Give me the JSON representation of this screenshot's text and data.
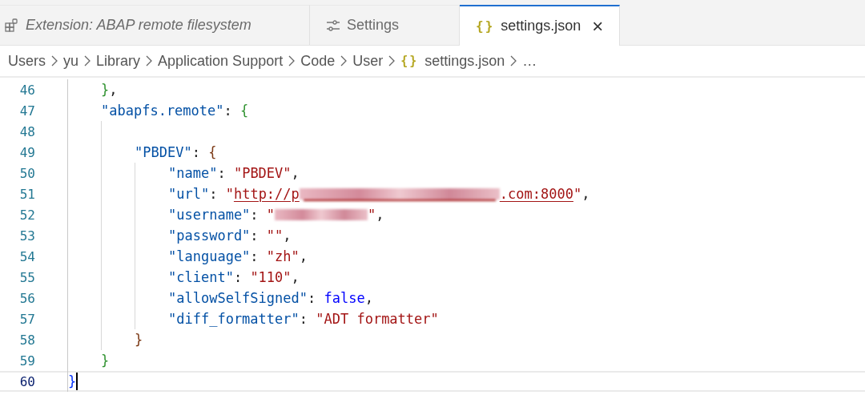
{
  "tabs": [
    {
      "kind": "extension",
      "label": "Extension: ABAP remote filesystem",
      "selected": false
    },
    {
      "kind": "settings",
      "label": "Settings",
      "selected": false
    },
    {
      "kind": "file",
      "glyph": "{}",
      "label": "settings.json",
      "selected": true
    }
  ],
  "close_glyph": "×",
  "breadcrumbs": [
    {
      "label": "Users"
    },
    {
      "label": "yu"
    },
    {
      "label": "Library"
    },
    {
      "label": "Application Support"
    },
    {
      "label": "Code"
    },
    {
      "label": "User"
    },
    {
      "glyph": "{}",
      "label": "settings.json"
    },
    {
      "label": "…"
    }
  ],
  "editor": {
    "lines": [
      {
        "number": "46",
        "current": false,
        "tokens": [
          {
            "kind": "brace1",
            "t": "}"
          },
          {
            "kind": "punct",
            "t": ","
          }
        ]
      },
      {
        "number": "47",
        "current": false,
        "tokens": [
          {
            "kind": "key",
            "t": "\"abapfs.remote\""
          },
          {
            "kind": "punct",
            "t": ": "
          },
          {
            "kind": "brace1",
            "t": "{"
          }
        ],
        "children": [
          {
            "number": "48",
            "current": false
          },
          {
            "number": "49",
            "current": false,
            "tokens": [
              {
                "kind": "key",
                "t": "\"PBDEV\""
              },
              {
                "kind": "punct",
                "t": ": "
              },
              {
                "kind": "brace2",
                "t": "{"
              }
            ],
            "children": [
              {
                "number": "50",
                "current": false,
                "tokens": [
                  {
                    "kind": "key",
                    "t": "\"name\""
                  },
                  {
                    "kind": "punct",
                    "t": ": "
                  },
                  {
                    "kind": "string",
                    "t": "\"PBDEV\""
                  },
                  {
                    "kind": "punct",
                    "t": ","
                  }
                ]
              },
              {
                "number": "51",
                "current": false,
                "tokens": [
                  {
                    "kind": "key",
                    "t": "\"url\""
                  },
                  {
                    "kind": "punct",
                    "t": ": "
                  },
                  {
                    "kind": "string",
                    "t": "\""
                  },
                  {
                    "kind": "link",
                    "t": "http://p"
                  },
                  {
                    "kind": "redacted_link"
                  },
                  {
                    "kind": "link",
                    "t": ".com:8000"
                  },
                  {
                    "kind": "string",
                    "t": "\""
                  },
                  {
                    "kind": "punct",
                    "t": ","
                  }
                ]
              },
              {
                "number": "52",
                "current": false,
                "tokens": [
                  {
                    "kind": "key",
                    "t": "\"username\""
                  },
                  {
                    "kind": "punct",
                    "t": ": "
                  },
                  {
                    "kind": "string",
                    "t": "\""
                  },
                  {
                    "kind": "redacted_string"
                  },
                  {
                    "kind": "string",
                    "t": "\""
                  },
                  {
                    "kind": "punct",
                    "t": ","
                  }
                ]
              },
              {
                "number": "53",
                "current": false,
                "tokens": [
                  {
                    "kind": "key",
                    "t": "\"password\""
                  },
                  {
                    "kind": "punct",
                    "t": ": "
                  },
                  {
                    "kind": "string",
                    "t": "\"\""
                  },
                  {
                    "kind": "punct",
                    "t": ","
                  }
                ]
              },
              {
                "number": "54",
                "current": false,
                "tokens": [
                  {
                    "kind": "key",
                    "t": "\"language\""
                  },
                  {
                    "kind": "punct",
                    "t": ": "
                  },
                  {
                    "kind": "string",
                    "t": "\"zh\""
                  },
                  {
                    "kind": "punct",
                    "t": ","
                  }
                ]
              },
              {
                "number": "55",
                "current": false,
                "tokens": [
                  {
                    "kind": "key",
                    "t": "\"client\""
                  },
                  {
                    "kind": "punct",
                    "t": ": "
                  },
                  {
                    "kind": "string",
                    "t": "\"110\""
                  },
                  {
                    "kind": "punct",
                    "t": ","
                  }
                ]
              },
              {
                "number": "56",
                "current": false,
                "tokens": [
                  {
                    "kind": "key",
                    "t": "\"allowSelfSigned\""
                  },
                  {
                    "kind": "punct",
                    "t": ": "
                  },
                  {
                    "kind": "bool",
                    "t": "false"
                  },
                  {
                    "kind": "punct",
                    "t": ","
                  }
                ]
              },
              {
                "number": "57",
                "current": false,
                "tokens": [
                  {
                    "kind": "key",
                    "t": "\"diff_formatter\""
                  },
                  {
                    "kind": "punct",
                    "t": ": "
                  },
                  {
                    "kind": "string",
                    "t": "\"ADT formatter\""
                  }
                ]
              }
            ]
          },
          {
            "number": "58",
            "current": false,
            "tokens": [
              {
                "kind": "brace2",
                "t": "}"
              }
            ]
          }
        ]
      },
      {
        "number": "59",
        "current": false,
        "tokens": [
          {
            "kind": "brace1",
            "t": "}"
          }
        ]
      }
    ],
    "root_lines": [
      {
        "number": "60",
        "current": true,
        "tokens": [
          {
            "kind": "brace0",
            "t": "}"
          }
        ]
      }
    ]
  }
}
